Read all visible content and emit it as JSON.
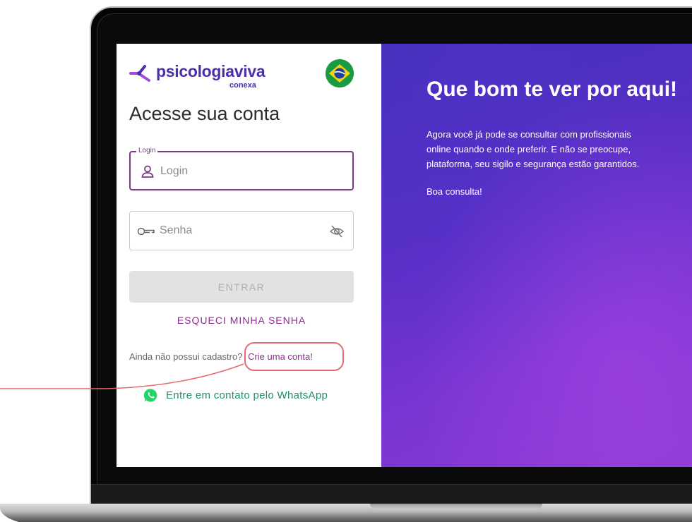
{
  "brand": {
    "name": "psicologiaviva",
    "subtitle": "conexa",
    "primary_color": "#4a2fb0",
    "accent_color": "#8a2f8e",
    "mark_icon": "psicologiaviva-logo-icon",
    "region_flag": "brazil-flag-icon"
  },
  "login_form": {
    "title": "Acesse sua conta",
    "login_field": {
      "legend": "Login",
      "placeholder": "Login",
      "value": "",
      "icon": "user-icon"
    },
    "password_field": {
      "placeholder": "Senha",
      "value": "",
      "icon": "key-icon",
      "toggle_icon": "eye-off-icon"
    },
    "submit_label": "ENTRAR",
    "forgot_label": "ESQUECI MINHA SENHA",
    "signup_prompt": "Ainda não possui cadastro?",
    "signup_link": "Crie uma conta!",
    "whatsapp_label": "Entre em contato pelo WhatsApp",
    "whatsapp_color": "#25d366"
  },
  "hero": {
    "title": "Que bom te ver por aqui!",
    "lines": [
      "Agora você já pode se consultar com profissionais",
      "online quando e onde preferir. E não se preocupe,",
      "plataforma, seu sigilo e segurança estão garantidos."
    ],
    "signoff": "Boa consulta!"
  },
  "annotation": {
    "color": "#e26a70",
    "highlight_target": "signup-link"
  }
}
